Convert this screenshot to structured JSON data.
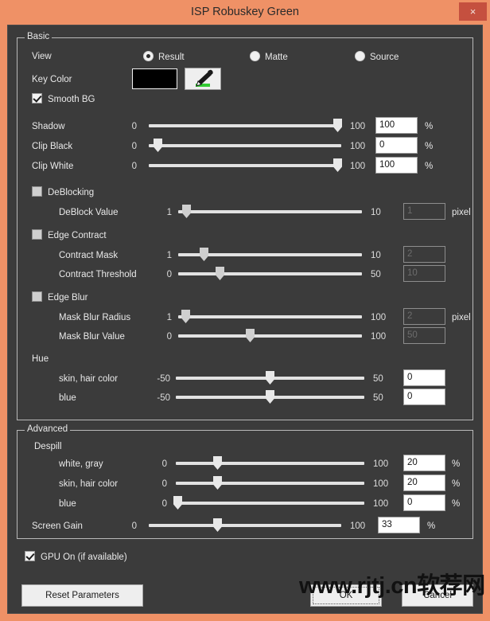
{
  "window": {
    "title": "ISP Robuskey Green",
    "close_label": "×",
    "titlebar_color": "#ef9166",
    "close_color": "#c5503f",
    "panel_color": "#3b3b3b"
  },
  "basic": {
    "group_label": "Basic",
    "view": {
      "label": "View",
      "options": [
        {
          "label": "Result",
          "checked": true
        },
        {
          "label": "Matte",
          "checked": false
        },
        {
          "label": "Source",
          "checked": false
        }
      ]
    },
    "key_color": {
      "label": "Key Color",
      "swatch_color": "#000000",
      "picker_icon": "eyedropper-icon"
    },
    "smooth_bg": {
      "label": "Smooth BG",
      "checked": true
    },
    "sliders": [
      {
        "label": "Shadow",
        "min": "0",
        "max": "100",
        "value": "100",
        "unit": "%",
        "enabled": true
      },
      {
        "label": "Clip Black",
        "min": "0",
        "max": "100",
        "value": "0",
        "unit": "%",
        "enabled": true
      },
      {
        "label": "Clip White",
        "min": "0",
        "max": "100",
        "value": "100",
        "unit": "%",
        "enabled": true
      }
    ],
    "deblocking": {
      "label": "DeBlocking",
      "checked": false,
      "slider": {
        "label": "DeBlock Value",
        "min": "1",
        "max": "10",
        "value": "1",
        "unit": "pixel",
        "enabled": false
      }
    },
    "edge_contract": {
      "label": "Edge Contract",
      "checked": false,
      "sliders": [
        {
          "label": "Contract Mask",
          "min": "1",
          "max": "10",
          "value": "2",
          "unit": "",
          "enabled": false
        },
        {
          "label": "Contract Threshold",
          "min": "0",
          "max": "50",
          "value": "10",
          "unit": "",
          "enabled": false
        }
      ]
    },
    "edge_blur": {
      "label": "Edge Blur",
      "checked": false,
      "sliders": [
        {
          "label": "Mask Blur Radius",
          "min": "1",
          "max": "100",
          "value": "2",
          "unit": "pixel",
          "enabled": false
        },
        {
          "label": "Mask Blur Value",
          "min": "0",
          "max": "100",
          "value": "50",
          "unit": "",
          "enabled": false
        }
      ]
    },
    "hue": {
      "label": "Hue",
      "sliders": [
        {
          "label": "skin, hair color",
          "min": "-50",
          "max": "50",
          "value": "0",
          "unit": "",
          "enabled": true
        },
        {
          "label": "blue",
          "min": "-50",
          "max": "50",
          "value": "0",
          "unit": "",
          "enabled": true
        }
      ]
    }
  },
  "advanced": {
    "group_label": "Advanced",
    "despill": {
      "label": "Despill",
      "sliders": [
        {
          "label": "white, gray",
          "min": "0",
          "max": "100",
          "value": "20",
          "unit": "%",
          "enabled": true
        },
        {
          "label": "skin, hair color",
          "min": "0",
          "max": "100",
          "value": "20",
          "unit": "%",
          "enabled": true
        },
        {
          "label": "blue",
          "min": "0",
          "max": "100",
          "value": "0",
          "unit": "%",
          "enabled": true
        }
      ]
    },
    "screen_gain": {
      "label": "Screen Gain",
      "min": "0",
      "max": "100",
      "value": "33",
      "unit": "%",
      "enabled": true
    }
  },
  "footer": {
    "gpu": {
      "label": "GPU On (if available)",
      "checked": true
    },
    "reset_label": "Reset Parameters",
    "ok_label": "OK",
    "cancel_label": "Cancel"
  },
  "watermark": {
    "text": "www.rjtj.cn软荐网"
  }
}
